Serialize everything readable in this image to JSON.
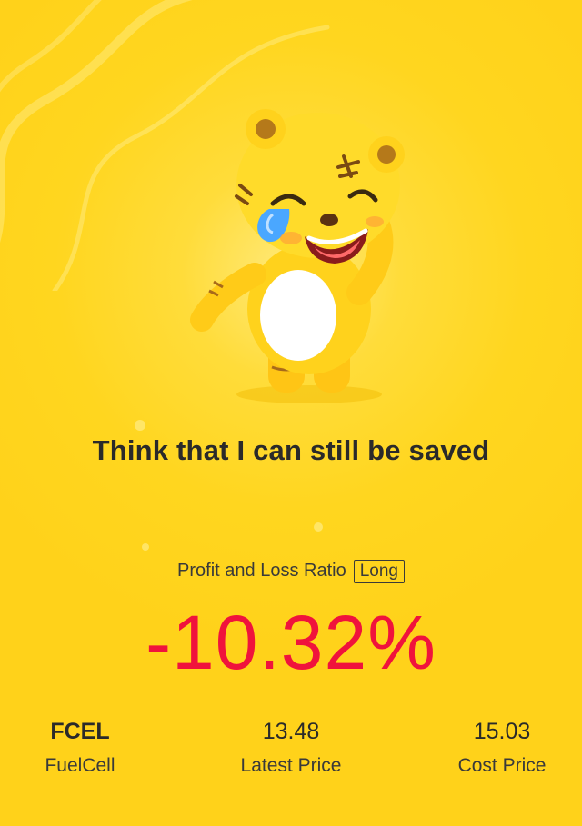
{
  "colors": {
    "background": "#ffd61f",
    "loss_red": "#f0133c",
    "text_dark": "#2a2a2a"
  },
  "mascot": {
    "icon": "crying-tiger-mascot-icon"
  },
  "headline": "Think that I can still be saved",
  "ratio": {
    "label": "Profit and Loss Ratio",
    "tag": "Long",
    "value": "-10.32%"
  },
  "stats": [
    {
      "value": "FCEL",
      "label": "FuelCell"
    },
    {
      "value": "13.48",
      "label": "Latest Price"
    },
    {
      "value": "15.03",
      "label": "Cost Price"
    }
  ]
}
